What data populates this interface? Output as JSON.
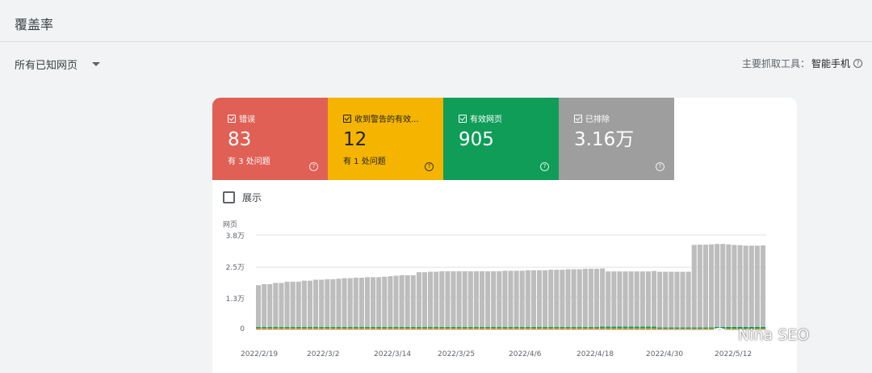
{
  "page": {
    "title": "覆盖率"
  },
  "filter": {
    "label": "所有已知网页"
  },
  "crawler": {
    "label": "主要抓取工具：",
    "value": "智能手机"
  },
  "tiles": [
    {
      "label": "错误",
      "value": "83",
      "sub": "有 3 处问题",
      "color": "#e06055"
    },
    {
      "label": "收到警告的有效...",
      "value": "12",
      "sub": "有 1 处问题",
      "color": "#f4b400"
    },
    {
      "label": "有效网页",
      "value": "905",
      "sub": "",
      "color": "#0f9d58"
    },
    {
      "label": "已排除",
      "value": "3.16万",
      "sub": "",
      "color": "#9e9e9e"
    }
  ],
  "show": {
    "label": "展示"
  },
  "watermark": {
    "text": "Nina SEO"
  },
  "chart_data": {
    "type": "bar",
    "stacked": true,
    "ylabel": "网页",
    "y_ticks": [
      "3.8万",
      "2.5万",
      "1.3万",
      "0"
    ],
    "y_tick_values": [
      38000,
      25000,
      13000,
      0
    ],
    "ylim": [
      0,
      38000
    ],
    "x_ticks": [
      "2022/2/19",
      "2022/3/2",
      "2022/3/14",
      "2022/3/25",
      "2022/4/6",
      "2022/4/18",
      "2022/4/30",
      "2022/5/12"
    ],
    "x_tick_positions": [
      0,
      11,
      23,
      34,
      46,
      58,
      70,
      82
    ],
    "grid": true,
    "series": [
      {
        "name": "错误",
        "color": "#d93025",
        "values": [
          200,
          200,
          200,
          200,
          200,
          200,
          200,
          200,
          200,
          200,
          200,
          200,
          200,
          200,
          200,
          200,
          200,
          200,
          200,
          200,
          200,
          200,
          200,
          200,
          200,
          200,
          200,
          200,
          200,
          200,
          200,
          200,
          200,
          200,
          200,
          200,
          200,
          200,
          200,
          200,
          200,
          200,
          200,
          200,
          200,
          200,
          200,
          200,
          200,
          200,
          200,
          200,
          200,
          200,
          200,
          200,
          200,
          200,
          200,
          200,
          120,
          120,
          120,
          120,
          120,
          120,
          120,
          120,
          120,
          120,
          90,
          90,
          90,
          90,
          90,
          90,
          90,
          90,
          90,
          90,
          90,
          90,
          90,
          90,
          90,
          90,
          90,
          90,
          90
        ]
      },
      {
        "name": "收到警告的有效",
        "color": "#f4b400",
        "values": [
          300,
          300,
          300,
          300,
          300,
          300,
          300,
          300,
          300,
          300,
          300,
          300,
          300,
          300,
          300,
          300,
          300,
          300,
          300,
          300,
          300,
          300,
          300,
          300,
          300,
          300,
          300,
          300,
          300,
          300,
          300,
          300,
          300,
          300,
          300,
          300,
          300,
          300,
          300,
          300,
          300,
          300,
          300,
          300,
          300,
          300,
          300,
          300,
          300,
          300,
          300,
          300,
          300,
          300,
          300,
          300,
          300,
          300,
          300,
          300,
          300,
          300,
          300,
          300,
          300,
          300,
          300,
          300,
          300,
          300,
          200,
          200,
          200,
          200,
          200,
          200,
          200,
          200,
          200,
          200,
          200,
          200,
          200,
          200,
          200,
          200,
          200,
          200,
          200
        ]
      },
      {
        "name": "有效网页",
        "color": "#0f9d58",
        "values": [
          500,
          500,
          500,
          500,
          500,
          500,
          500,
          500,
          500,
          500,
          500,
          500,
          500,
          500,
          500,
          500,
          500,
          500,
          500,
          500,
          500,
          500,
          500,
          500,
          500,
          500,
          500,
          500,
          500,
          500,
          500,
          500,
          500,
          500,
          500,
          500,
          500,
          500,
          500,
          500,
          500,
          500,
          500,
          500,
          500,
          500,
          500,
          500,
          500,
          500,
          500,
          500,
          500,
          500,
          500,
          500,
          500,
          500,
          500,
          500,
          700,
          700,
          700,
          700,
          700,
          700,
          700,
          700,
          700,
          700,
          500,
          500,
          500,
          500,
          500,
          500,
          500,
          500,
          500,
          500,
          700,
          700,
          700,
          700,
          700,
          700,
          700,
          700,
          700
        ]
      },
      {
        "name": "已排除",
        "color": "#bdbdbd",
        "values": [
          16800,
          17200,
          17200,
          17700,
          17700,
          18200,
          18200,
          18200,
          18600,
          18600,
          19000,
          19000,
          19200,
          19200,
          19400,
          19600,
          19600,
          19800,
          19800,
          20000,
          20000,
          20000,
          20200,
          20400,
          20600,
          20800,
          20800,
          20800,
          22000,
          22000,
          22200,
          22200,
          22400,
          22400,
          22400,
          22400,
          22400,
          22400,
          22400,
          22400,
          22400,
          22400,
          22400,
          22600,
          22600,
          22600,
          22600,
          22800,
          22800,
          22800,
          22800,
          23000,
          23000,
          23000,
          23200,
          23200,
          23200,
          23400,
          23400,
          23400,
          23400,
          22200,
          22200,
          22200,
          22200,
          22200,
          22200,
          22200,
          22200,
          22400,
          22400,
          22400,
          22400,
          22400,
          22400,
          22400,
          33200,
          33300,
          33300,
          33400,
          33400,
          33400,
          33200,
          33000,
          32900,
          32700,
          32700,
          32700,
          32800,
          32800,
          32600,
          32300,
          32300,
          32200,
          32200,
          32100,
          31900,
          31900,
          31800,
          31700
        ]
      }
    ]
  }
}
